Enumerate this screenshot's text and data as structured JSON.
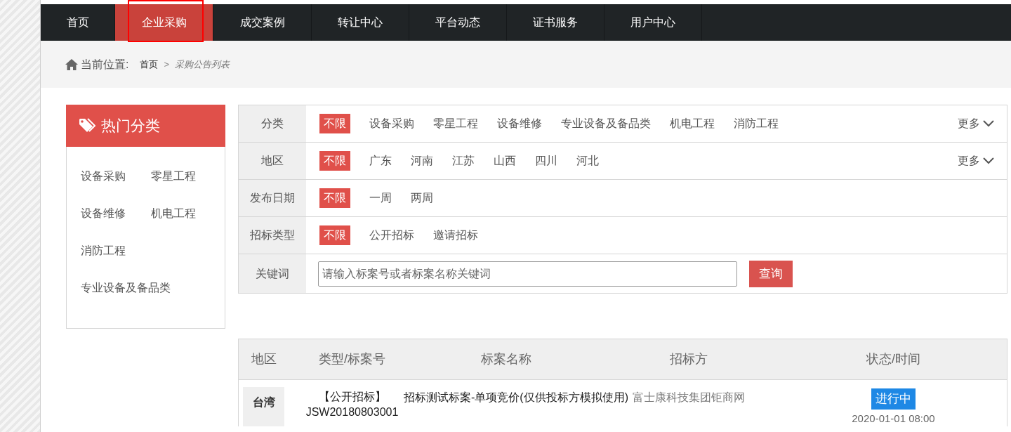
{
  "nav": [
    {
      "label": "首页",
      "selected": false
    },
    {
      "label": "企业采购",
      "selected": true
    },
    {
      "label": "成交案例",
      "selected": false
    },
    {
      "label": "转让中心",
      "selected": false
    },
    {
      "label": "平台动态",
      "selected": false
    },
    {
      "label": "证书服务",
      "selected": false
    },
    {
      "label": "用户中心",
      "selected": false
    }
  ],
  "breadcrumb": {
    "label": "当前位置:",
    "items": [
      "首页",
      "采购公告列表"
    ],
    "separator": ">"
  },
  "sidebar": {
    "title": "热门分类",
    "items": [
      "设备采购",
      "零星工程",
      "设备维修",
      "机电工程",
      "消防工程",
      "专业设备及备品类"
    ]
  },
  "filters": [
    {
      "label": "分类",
      "options": [
        {
          "label": "不限",
          "selected": true
        },
        {
          "label": "设备采购",
          "selected": false
        },
        {
          "label": "零星工程",
          "selected": false
        },
        {
          "label": "设备维修",
          "selected": false
        },
        {
          "label": "专业设备及备品类",
          "selected": false
        },
        {
          "label": "机电工程",
          "selected": false
        },
        {
          "label": "消防工程",
          "selected": false
        }
      ],
      "more": "更多"
    },
    {
      "label": "地区",
      "options": [
        {
          "label": "不限",
          "selected": true
        },
        {
          "label": "广东",
          "selected": false
        },
        {
          "label": "河南",
          "selected": false
        },
        {
          "label": "江苏",
          "selected": false
        },
        {
          "label": "山西",
          "selected": false
        },
        {
          "label": "四川",
          "selected": false
        },
        {
          "label": "河北",
          "selected": false
        }
      ],
      "more": "更多"
    },
    {
      "label": "发布日期",
      "options": [
        {
          "label": "不限",
          "selected": true
        },
        {
          "label": "一周",
          "selected": false
        },
        {
          "label": "两周",
          "selected": false
        }
      ]
    },
    {
      "label": "招标类型",
      "options": [
        {
          "label": "不限",
          "selected": true
        },
        {
          "label": "公开招标",
          "selected": false
        },
        {
          "label": "邀请招标",
          "selected": false
        }
      ]
    }
  ],
  "keyword": {
    "label": "关键词",
    "placeholder": "请输入标案号或者标案名称关键词",
    "button": "查询"
  },
  "table": {
    "columns": [
      "地区",
      "类型/标案号",
      "标案名称",
      "招标方",
      "状态/时间"
    ],
    "rows": [
      {
        "region": "台湾",
        "type": "【公开招标】",
        "number": "JSW20180803001",
        "name": "招标测试标案-单项竞价(仅供投标方模拟使用)",
        "buyer": "富士康科技集团钜商网",
        "status": "进行中",
        "time": "2020-01-01 08:00"
      }
    ]
  }
}
